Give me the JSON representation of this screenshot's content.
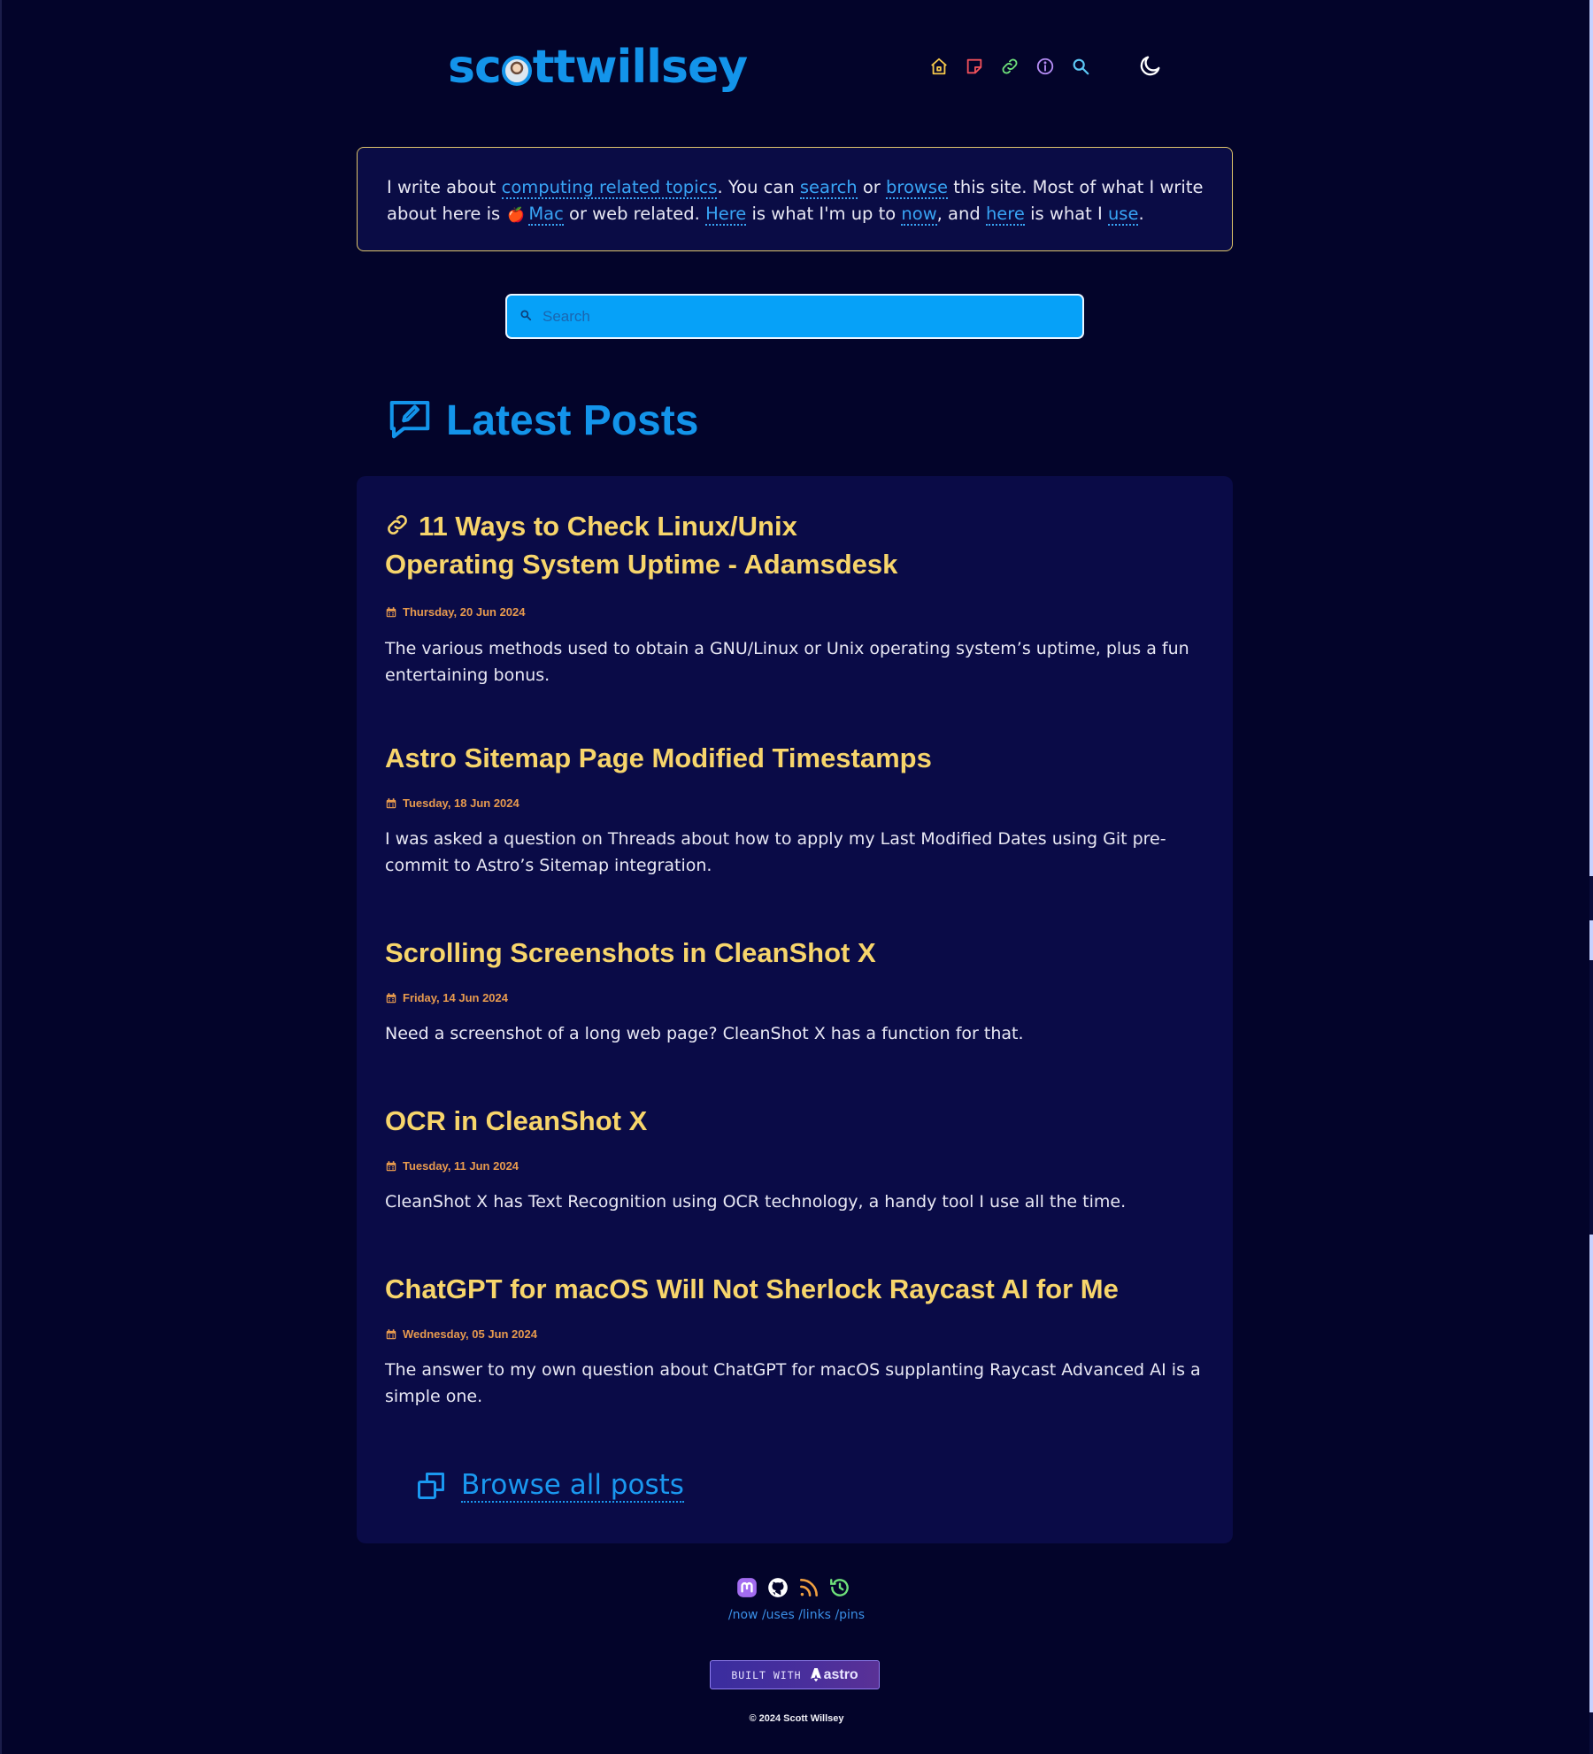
{
  "site": {
    "logo_prefix": "sc",
    "logo_suffix": "ttwillsey"
  },
  "nav": {
    "items": [
      {
        "name": "home-icon",
        "color": "#f5c84a"
      },
      {
        "name": "notes-icon",
        "color": "#f0505a"
      },
      {
        "name": "link-icon",
        "color": "#6ee07a"
      },
      {
        "name": "info-icon",
        "color": "#b58cf5"
      },
      {
        "name": "search-icon",
        "color": "#5cc8f5"
      }
    ],
    "theme_icon": "moon-icon"
  },
  "intro": {
    "t1": "I write about ",
    "l1": "computing related topics",
    "t2": ". You can ",
    "l2": "search",
    "t3": " or ",
    "l3": "browse",
    "t4": " this site. Most of what I write about here is ",
    "apple": "🍎",
    "l4": "Mac",
    "t5": " or web related. ",
    "l5": "Here",
    "t6": " is what I'm up to ",
    "l6": "now",
    "t7": ", and ",
    "l7": "here",
    "t8": " is what I ",
    "l8": "use",
    "t9": "."
  },
  "search": {
    "placeholder": "Search"
  },
  "latest": {
    "heading": "Latest Posts"
  },
  "posts": [
    {
      "title": "11 Ways to Check Linux/Unix Operating System Uptime - Adamsdesk",
      "title_line1": "11 Ways to Check Linux/Unix",
      "title_line2": "Operating System Uptime - Adamsdesk",
      "is_link": true,
      "date": "Thursday, 20 Jun 2024",
      "excerpt": "The various methods used to obtain a GNU/Linux or Unix operating system’s uptime, plus a fun entertaining bonus."
    },
    {
      "title": "Astro Sitemap Page Modified Timestamps",
      "is_link": false,
      "date": "Tuesday, 18 Jun 2024",
      "excerpt": "I was asked a question on Threads about how to apply my Last Modified Dates using Git pre-commit to Astro’s Sitemap integration."
    },
    {
      "title": "Scrolling Screenshots in CleanShot X",
      "is_link": false,
      "date": "Friday, 14 Jun 2024",
      "excerpt": "Need a screenshot of a long web page? CleanShot X has a function for that."
    },
    {
      "title": "OCR in CleanShot X",
      "is_link": false,
      "date": "Tuesday, 11 Jun 2024",
      "excerpt": "CleanShot X has Text Recognition using OCR technology, a handy tool I use all the time."
    },
    {
      "title": "ChatGPT for macOS Will Not Sherlock Raycast AI for Me",
      "is_link": false,
      "date": "Wednesday, 05 Jun 2024",
      "excerpt": "The answer to my own question about ChatGPT for macOS supplanting Raycast Advanced AI is a simple one."
    }
  ],
  "browse": {
    "label": "Browse all posts"
  },
  "footer": {
    "social": [
      {
        "name": "mastodon-icon",
        "color": "#a36cf0"
      },
      {
        "name": "github-icon",
        "color": "#ffffff"
      },
      {
        "name": "rss-icon",
        "color": "#f0a040"
      },
      {
        "name": "clock-icon",
        "color": "#6ee07a"
      }
    ],
    "links": [
      "/now",
      "/uses",
      "/links",
      "/pins"
    ],
    "built_with": "BUILT WITH",
    "astro": "astro",
    "copyright": "© 2024 Scott Willsey"
  },
  "colors": {
    "background": "#03042a",
    "card": "#0a0b47",
    "accent_blue": "#1394ea",
    "title_yellow": "#f7d56b",
    "date_orange": "#e79a4e",
    "intro_border": "#e0c66a"
  }
}
